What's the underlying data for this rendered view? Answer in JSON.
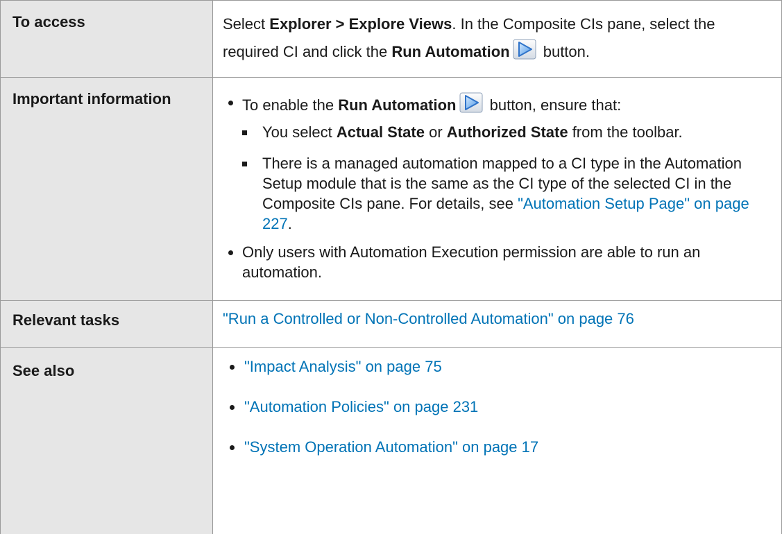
{
  "rows": {
    "access": {
      "header": "To access",
      "t1": "Select ",
      "b1": "Explorer > Explore Views",
      "t2": ". In the Composite CIs pane, select the required CI and click the ",
      "b2": "Run Automation",
      "t3": " button."
    },
    "info": {
      "header": "Important information",
      "item1": {
        "t1": "To enable the ",
        "b1": "Run Automation",
        "t2": " button, ensure that:",
        "sub1": {
          "t1": "You select ",
          "b1": "Actual State",
          "t2": " or ",
          "b2": "Authorized State",
          "t3": " from the toolbar."
        },
        "sub2": {
          "t1": "There is a managed automation mapped to a CI type in the Automation Setup module that is the same as the CI type of the selected CI in the Composite CIs pane. For details, see ",
          "link": "\"Automation Setup Page\" on page 227",
          "t2": "."
        }
      },
      "item2": "Only users with Automation Execution permission are able to run an automation."
    },
    "tasks": {
      "header": "Relevant tasks",
      "link": "\"Run a Controlled or Non-Controlled Automation\" on page 76"
    },
    "see": {
      "header": "See also",
      "links": [
        "\"Impact Analysis\" on page 75",
        "\"Automation Policies\" on page 231",
        "\"System Operation Automation\" on page 17"
      ]
    }
  },
  "colors": {
    "header_bg": "#e6e6e6",
    "border": "#9a9a9a",
    "link": "#0073b6",
    "icon_blue": "#3a7fd5"
  },
  "icons": {
    "run_automation": "play-triangle-icon"
  }
}
